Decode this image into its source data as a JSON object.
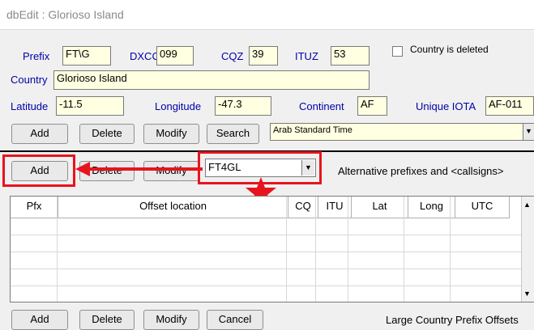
{
  "window": {
    "title": "dbEdit : Glorioso Island"
  },
  "top": {
    "prefix_label": "Prefix",
    "prefix_value": "FT\\G",
    "dxcc_label": "DXCC",
    "dxcc_value": "099",
    "cqz_label": "CQZ",
    "cqz_value": "39",
    "ituz_label": "ITUZ",
    "ituz_value": "53",
    "deleted_label": "Country is deleted",
    "country_label": "Country",
    "country_value": "Glorioso Island",
    "latitude_label": "Latitude",
    "latitude_value": "-11.5",
    "longitude_label": "Longitude",
    "longitude_value": "-47.3",
    "continent_label": "Continent",
    "continent_value": "AF",
    "iota_label": "Unique IOTA",
    "iota_value": "AF-011",
    "buttons": [
      "Add",
      "Delete",
      "Modify",
      "Search"
    ],
    "timezone_value": "Arab Standard Time"
  },
  "alt": {
    "buttons": [
      "Add",
      "Delete",
      "Modify"
    ],
    "prefix_select": "FT4GL",
    "caption": "Alternative prefixes and <callsigns>"
  },
  "offsets": {
    "columns": [
      "Pfx",
      "Offset location",
      "CQ",
      "ITU",
      "Lat",
      "Long",
      "UTC"
    ],
    "buttons": [
      "Add",
      "Delete",
      "Modify",
      "Cancel"
    ],
    "caption": "Large Country Prefix Offsets"
  },
  "annotation": {
    "color": "#e8141d"
  }
}
